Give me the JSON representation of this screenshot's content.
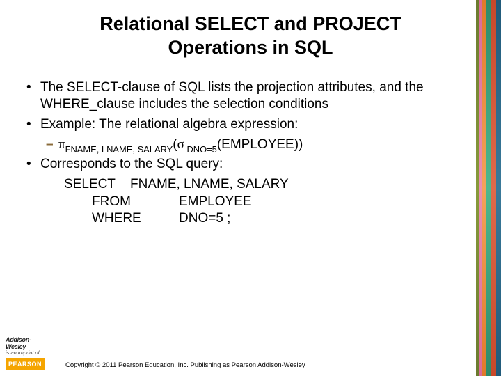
{
  "title": "Relational SELECT and PROJECT Operations in SQL",
  "bullets": {
    "b1": "The SELECT-clause of SQL lists the projection attributes, and the WHERE_clause includes the selection conditions",
    "b2": "Example: The relational algebra expression:",
    "b3": "Corresponds to the SQL query:"
  },
  "algebra": {
    "pi": "π",
    "piSub": "FNAME, LNAME, SALARY",
    "sigma": "σ",
    "sigmaSub": " DNO=5",
    "relation": "(EMPLOYEE))"
  },
  "sql": {
    "l1a": "SELECT",
    "l1b": "FNAME, LNAME, SALARY",
    "l2a": "FROM",
    "l2b": "EMPLOYEE",
    "l3a": "WHERE",
    "l3b": "DNO=5 ;"
  },
  "logo": {
    "brand": "Addison-Wesley",
    "imprint": "is an imprint of",
    "pearson": "PEARSON"
  },
  "copyright": "Copyright © 2011 Pearson Education, Inc. Publishing as Pearson Addison-Wesley"
}
